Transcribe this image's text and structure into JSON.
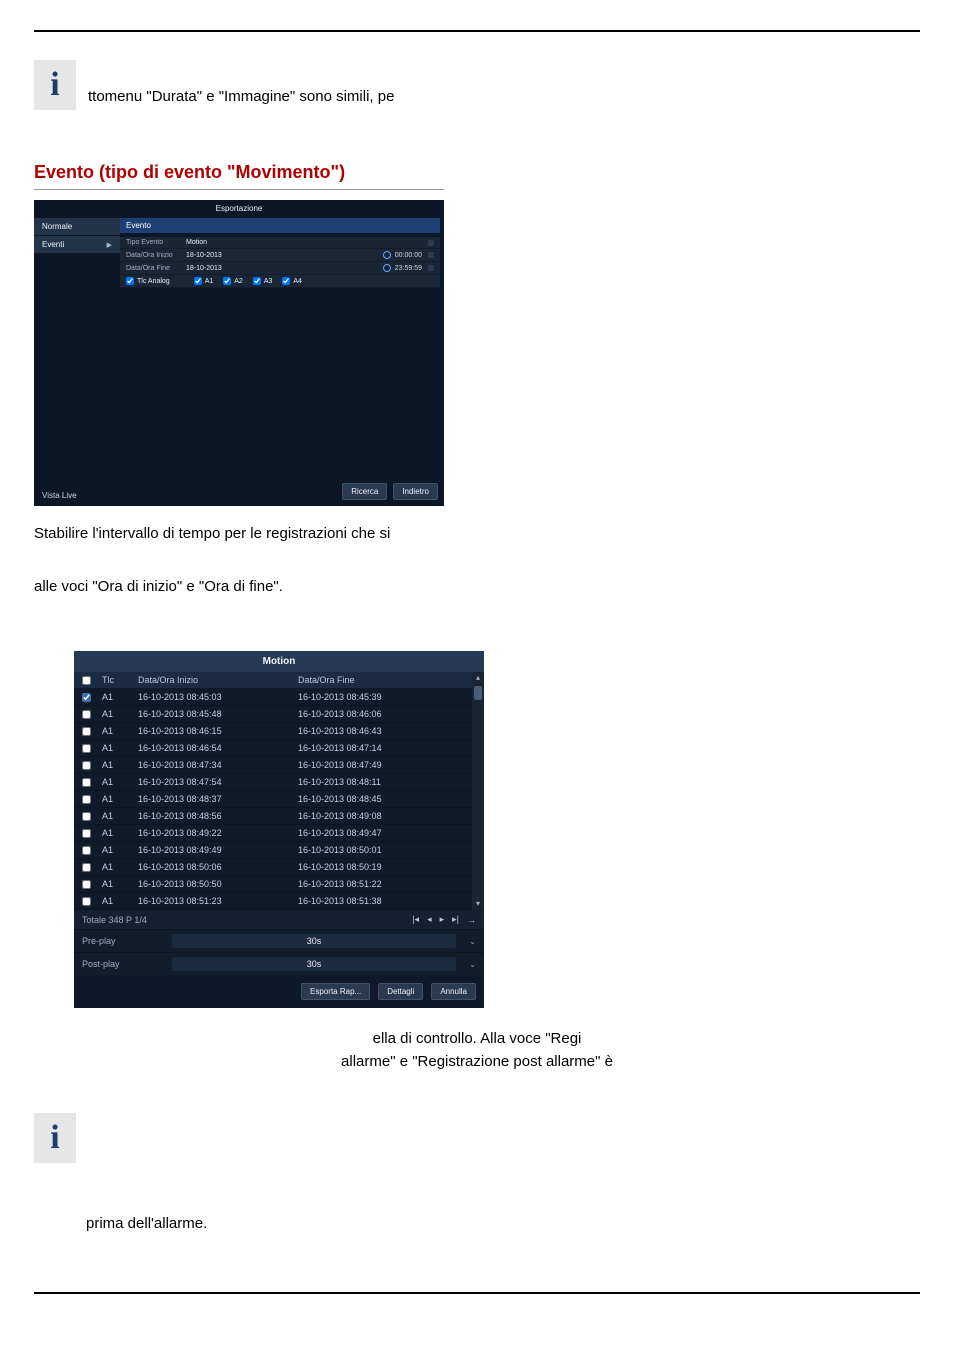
{
  "info_blocks": {
    "top_text": "ttomenu \"Durata\" e \"Immagine\" sono simili, pe",
    "bottom_text": "prima dell'allarme."
  },
  "section_heading": "Evento (tipo di evento \"Movimento\")",
  "fig1": {
    "window_title": "Esportazione",
    "tabs": {
      "normale": "Normale",
      "eventi": "Eventi"
    },
    "event_panel_title": "Evento",
    "rows": {
      "tipo_evento": {
        "label": "Tipo Evento",
        "value": "Motion"
      },
      "inizio": {
        "label": "Data/Ora Inizio",
        "value": "18-10-2013",
        "time": "00:00:00"
      },
      "fine": {
        "label": "Data/Ora Fine",
        "value": "18-10-2013",
        "time": "23:59:59"
      }
    },
    "camera_row": {
      "label": "Tlc Analog",
      "items": [
        "A1",
        "A2",
        "A3",
        "A4"
      ]
    },
    "buttons": {
      "ricerca": "Ricerca",
      "indietro": "Indietro"
    },
    "live_label": "Vista Live"
  },
  "paragraph_after_fig1_line1": "Stabilire l'intervallo di tempo per le registrazioni che si",
  "paragraph_after_fig1_line2": "alle voci \"Ora di inizio\" e \"Ora di fine\".",
  "fig2": {
    "title": "Motion",
    "columns": {
      "tlc": "Tlc",
      "start": "Data/Ora Inizio",
      "end": "Data/Ora Fine"
    },
    "rows": [
      {
        "tlc": "A1",
        "start": "16-10-2013 08:45:03",
        "end": "16-10-2013 08:45:39"
      },
      {
        "tlc": "A1",
        "start": "16-10-2013 08:45:48",
        "end": "16-10-2013 08:46:06"
      },
      {
        "tlc": "A1",
        "start": "16-10-2013 08:46:15",
        "end": "16-10-2013 08:46:43"
      },
      {
        "tlc": "A1",
        "start": "16-10-2013 08:46:54",
        "end": "16-10-2013 08:47:14"
      },
      {
        "tlc": "A1",
        "start": "16-10-2013 08:47:34",
        "end": "16-10-2013 08:47:49"
      },
      {
        "tlc": "A1",
        "start": "16-10-2013 08:47:54",
        "end": "16-10-2013 08:48:11"
      },
      {
        "tlc": "A1",
        "start": "16-10-2013 08:48:37",
        "end": "16-10-2013 08:48:45"
      },
      {
        "tlc": "A1",
        "start": "16-10-2013 08:48:56",
        "end": "16-10-2013 08:49:08"
      },
      {
        "tlc": "A1",
        "start": "16-10-2013 08:49:22",
        "end": "16-10-2013 08:49:47"
      },
      {
        "tlc": "A1",
        "start": "16-10-2013 08:49:49",
        "end": "16-10-2013 08:50:01"
      },
      {
        "tlc": "A1",
        "start": "16-10-2013 08:50:06",
        "end": "16-10-2013 08:50:19"
      },
      {
        "tlc": "A1",
        "start": "16-10-2013 08:50:50",
        "end": "16-10-2013 08:51:22"
      },
      {
        "tlc": "A1",
        "start": "16-10-2013 08:51:23",
        "end": "16-10-2013 08:51:38"
      }
    ],
    "totals": "Totale 348 P 1/4",
    "nav": {
      "first": "|◂",
      "prev": "◂",
      "next": "▸",
      "last": "▸|",
      "go": "→"
    },
    "settings": {
      "preplay_label": "Pre-play",
      "preplay_value": "30s",
      "postplay_label": "Post-play",
      "postplay_value": "30s"
    },
    "buttons": {
      "export": "Esporta Rap...",
      "details": "Dettagli",
      "cancel": "Annulla"
    }
  },
  "centered_text_line1": "ella di controllo. Alla voce \"Regi",
  "centered_text_line2": "allarme\" e \"Registrazione post allarme\" è"
}
